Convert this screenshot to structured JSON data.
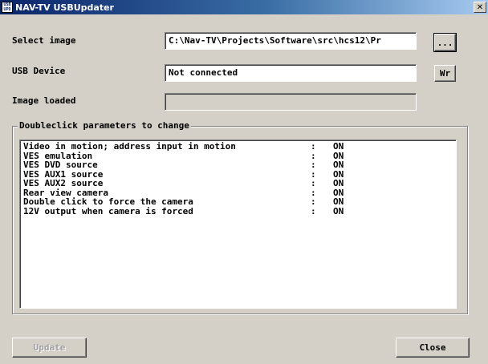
{
  "window": {
    "icon_text_top": "USB",
    "icon_text_bottom": "UPD",
    "title": "NAV-TV USBUpdater",
    "close_glyph": "✕"
  },
  "form": {
    "select_image_label": "Select image",
    "select_image_value": "C:\\Nav-TV\\Projects\\Software\\src\\hcs12\\Pr",
    "browse_label": "...",
    "usb_device_label": "USB Device",
    "usb_device_value": "Not connected",
    "wr_label": "Wr",
    "image_loaded_label": "Image loaded",
    "image_loaded_value": ""
  },
  "params": {
    "group_title": "Doubleclick parameters to change",
    "separator": ":",
    "items": [
      {
        "name": "Video in motion; address input in motion",
        "value": "ON"
      },
      {
        "name": "VES emulation",
        "value": "ON"
      },
      {
        "name": "VES DVD source",
        "value": "ON"
      },
      {
        "name": "VES AUX1 source",
        "value": "ON"
      },
      {
        "name": "VES AUX2 source",
        "value": "ON"
      },
      {
        "name": "Rear view camera",
        "value": "ON"
      },
      {
        "name": "Double click to force the camera",
        "value": "ON"
      },
      {
        "name": "12V output when camera is forced",
        "value": "ON"
      }
    ]
  },
  "footer": {
    "update_label": "Update",
    "close_label": "Close"
  }
}
